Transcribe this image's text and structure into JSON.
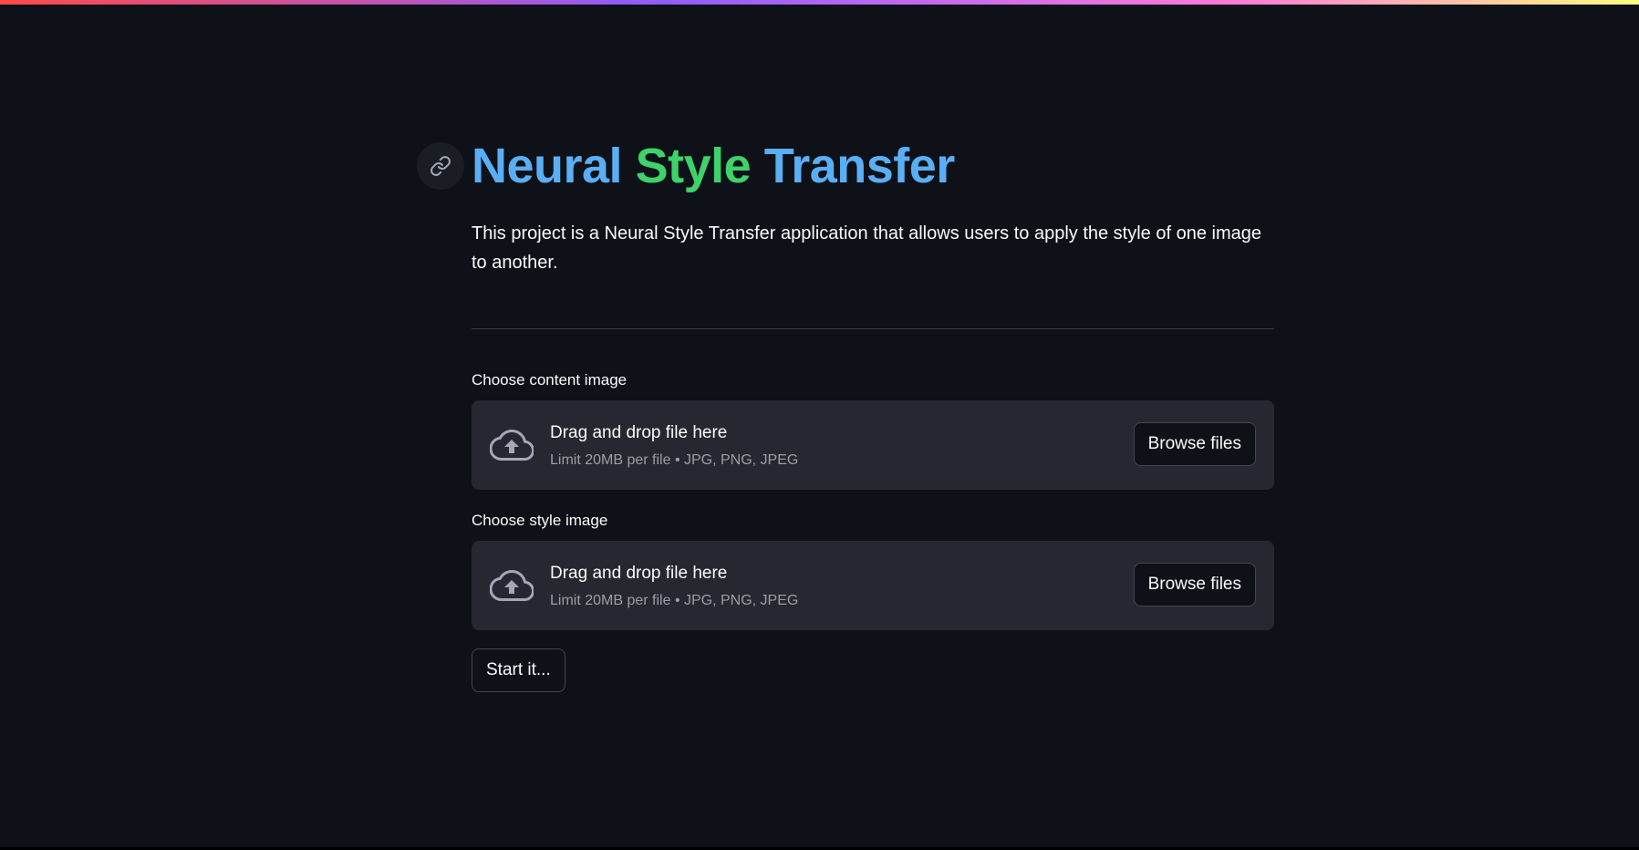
{
  "header": {
    "title_parts": [
      {
        "text": "Neural",
        "color": "#5aaef5"
      },
      {
        "text": "Style",
        "color": "#3dd26a"
      },
      {
        "text": "Transfer",
        "color": "#5aaef5"
      }
    ],
    "anchor_icon": "link-icon"
  },
  "description": "This project is a Neural Style Transfer application that allows users to apply the style of one image to another.",
  "uploaders": [
    {
      "label": "Choose content image",
      "drop_title": "Drag and drop file here",
      "limit_text": "Limit 20MB per file • JPG, PNG, JPEG",
      "button_label": "Browse files",
      "icon": "cloud-upload-icon"
    },
    {
      "label": "Choose style image",
      "drop_title": "Drag and drop file here",
      "limit_text": "Limit 20MB per file • JPG, PNG, JPEG",
      "button_label": "Browse files",
      "icon": "cloud-upload-icon"
    }
  ],
  "start_button": {
    "label": "Start it..."
  },
  "colors": {
    "background": "#0e1117",
    "dropzone": "#262730",
    "title_blue": "#5aaef5",
    "title_green": "#3dd26a"
  }
}
